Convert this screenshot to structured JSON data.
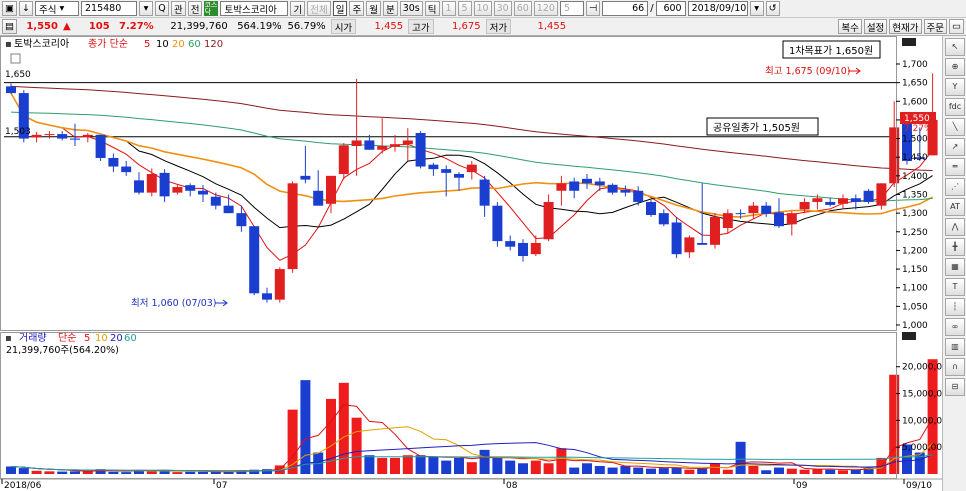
{
  "toolbar1": {
    "market": "주식",
    "code": "215480",
    "btn_rel": "관",
    "btn_all": "전",
    "badge": "코스닥",
    "stock_name": "토박스코리아",
    "btn_period": "기",
    "btn_all2": "전체",
    "periods": [
      "일",
      "주",
      "월",
      "분",
      "30s",
      "틱"
    ],
    "period_nums": [
      "1",
      "5",
      "10",
      "30",
      "60",
      "120"
    ],
    "spin_value": "5",
    "count": "66",
    "total": "600",
    "date": "2018/09/10"
  },
  "toolbar2": {
    "price": "1,550",
    "change_arrow": "▲",
    "change": "105",
    "change_pct": "7.27%",
    "volume": "21,399,760",
    "vol_pct": "564.19%",
    "rate": "56.79%",
    "open_label": "시가",
    "open": "1,455",
    "high_label": "고가",
    "high": "1,675",
    "low_label": "저가",
    "low": "1,455",
    "buttons": [
      "복수",
      "설정",
      "현재가",
      "주문"
    ]
  },
  "price_panel": {
    "name": "토박스코리아",
    "ma_label": "종가 단순",
    "ma_periods": [
      "5",
      "10",
      "20",
      "60",
      "120"
    ],
    "ma_colors": [
      "#e01010",
      "#000000",
      "#f09010",
      "#2e9e6a",
      "#8b1a1a"
    ],
    "hline_label": "1,650",
    "hline_left": "1,503",
    "target_box": "1차목표가 1,650원",
    "high_note": "최고 1,675 (09/10)",
    "offer_box": "공유일종가 1,505원",
    "low_note": "최저 1,060 (07/03)",
    "price_tag": "1,550",
    "pct_tag": "7.27%",
    "y_ticks": [
      "1,700",
      "1,650",
      "1,600",
      "1,550",
      "1,500",
      "1,450",
      "1,400",
      "1,350",
      "1,300",
      "1,250",
      "1,200",
      "1,150",
      "1,100",
      "1,050",
      "1,000"
    ]
  },
  "volume_panel": {
    "label": "거래량",
    "ma_label": "단순",
    "ma_periods": [
      "5",
      "10",
      "20",
      "60"
    ],
    "ma_colors": [
      "#e01010",
      "#e0a000",
      "#2020c0",
      "#20a0a0"
    ],
    "value": "21,399,760주(564.20%)",
    "y_ticks": [
      "20,000,00",
      "15,000,00",
      "10,000,00",
      "5,000,00"
    ]
  },
  "x_axis": [
    "2018/06",
    "07",
    "08",
    "09",
    "09/10"
  ],
  "colors": {
    "up": "#e02020",
    "down": "#1a3fd0",
    "hline": "#000000",
    "vol_up": "#ee1c1c",
    "vol_down": "#1a3fd0"
  },
  "right_tools": [
    "cursor-icon",
    "zoom-icon",
    "indicator-icon",
    "fdc-icon",
    "trend-line-icon",
    "arrow-line-icon",
    "parallel-icon",
    "fan-icon",
    "auto-icon",
    "wave-icon",
    "cross-icon",
    "grid-icon",
    "text-icon",
    "vertical-line-icon",
    "link-all-icon",
    "chart-icon",
    "magnet-icon",
    "lock-icon"
  ],
  "chart_data": {
    "type": "candlestick",
    "ylim": [
      1000,
      1700
    ],
    "candles": [
      {
        "o": 1640,
        "h": 1648,
        "l": 1620,
        "c": 1622
      },
      {
        "o": 1622,
        "h": 1630,
        "l": 1490,
        "c": 1500
      },
      {
        "o": 1503,
        "h": 1518,
        "l": 1490,
        "c": 1510
      },
      {
        "o": 1510,
        "h": 1520,
        "l": 1500,
        "c": 1512
      },
      {
        "o": 1512,
        "h": 1520,
        "l": 1495,
        "c": 1500
      },
      {
        "o": 1500,
        "h": 1540,
        "l": 1480,
        "c": 1497
      },
      {
        "o": 1506,
        "h": 1515,
        "l": 1490,
        "c": 1510
      },
      {
        "o": 1510,
        "h": 1510,
        "l": 1440,
        "c": 1448
      },
      {
        "o": 1448,
        "h": 1460,
        "l": 1410,
        "c": 1425
      },
      {
        "o": 1425,
        "h": 1440,
        "l": 1400,
        "c": 1410
      },
      {
        "o": 1388,
        "h": 1410,
        "l": 1350,
        "c": 1355
      },
      {
        "o": 1355,
        "h": 1420,
        "l": 1345,
        "c": 1405
      },
      {
        "o": 1408,
        "h": 1418,
        "l": 1330,
        "c": 1345
      },
      {
        "o": 1355,
        "h": 1375,
        "l": 1350,
        "c": 1370
      },
      {
        "o": 1375,
        "h": 1380,
        "l": 1345,
        "c": 1360
      },
      {
        "o": 1360,
        "h": 1375,
        "l": 1330,
        "c": 1350
      },
      {
        "o": 1344,
        "h": 1355,
        "l": 1310,
        "c": 1320
      },
      {
        "o": 1320,
        "h": 1350,
        "l": 1300,
        "c": 1300
      },
      {
        "o": 1300,
        "h": 1320,
        "l": 1250,
        "c": 1265
      },
      {
        "o": 1265,
        "h": 1265,
        "l": 1080,
        "c": 1085
      },
      {
        "o": 1085,
        "h": 1100,
        "l": 1060,
        "c": 1068
      },
      {
        "o": 1068,
        "h": 1155,
        "l": 1060,
        "c": 1150
      },
      {
        "o": 1150,
        "h": 1385,
        "l": 1140,
        "c": 1380
      },
      {
        "o": 1400,
        "h": 1480,
        "l": 1380,
        "c": 1390
      },
      {
        "o": 1360,
        "h": 1415,
        "l": 1330,
        "c": 1320
      },
      {
        "o": 1325,
        "h": 1400,
        "l": 1300,
        "c": 1400
      },
      {
        "o": 1405,
        "h": 1488,
        "l": 1390,
        "c": 1482
      },
      {
        "o": 1480,
        "h": 1660,
        "l": 1400,
        "c": 1495
      },
      {
        "o": 1495,
        "h": 1510,
        "l": 1470,
        "c": 1470
      },
      {
        "o": 1470,
        "h": 1555,
        "l": 1460,
        "c": 1480
      },
      {
        "o": 1478,
        "h": 1510,
        "l": 1465,
        "c": 1485
      },
      {
        "o": 1485,
        "h": 1528,
        "l": 1440,
        "c": 1495
      },
      {
        "o": 1515,
        "h": 1520,
        "l": 1420,
        "c": 1425
      },
      {
        "o": 1430,
        "h": 1435,
        "l": 1400,
        "c": 1418
      },
      {
        "o": 1418,
        "h": 1428,
        "l": 1345,
        "c": 1408
      },
      {
        "o": 1405,
        "h": 1410,
        "l": 1360,
        "c": 1395
      },
      {
        "o": 1410,
        "h": 1440,
        "l": 1390,
        "c": 1430
      },
      {
        "o": 1390,
        "h": 1400,
        "l": 1290,
        "c": 1320
      },
      {
        "o": 1320,
        "h": 1330,
        "l": 1210,
        "c": 1225
      },
      {
        "o": 1225,
        "h": 1240,
        "l": 1200,
        "c": 1210
      },
      {
        "o": 1220,
        "h": 1230,
        "l": 1170,
        "c": 1185
      },
      {
        "o": 1190,
        "h": 1240,
        "l": 1185,
        "c": 1220
      },
      {
        "o": 1230,
        "h": 1350,
        "l": 1225,
        "c": 1330
      },
      {
        "o": 1360,
        "h": 1400,
        "l": 1320,
        "c": 1380
      },
      {
        "o": 1385,
        "h": 1395,
        "l": 1340,
        "c": 1360
      },
      {
        "o": 1392,
        "h": 1405,
        "l": 1365,
        "c": 1380
      },
      {
        "o": 1385,
        "h": 1395,
        "l": 1360,
        "c": 1375
      },
      {
        "o": 1376,
        "h": 1380,
        "l": 1350,
        "c": 1355
      },
      {
        "o": 1362,
        "h": 1374,
        "l": 1345,
        "c": 1355
      },
      {
        "o": 1360,
        "h": 1372,
        "l": 1320,
        "c": 1330
      },
      {
        "o": 1330,
        "h": 1335,
        "l": 1290,
        "c": 1295
      },
      {
        "o": 1300,
        "h": 1310,
        "l": 1265,
        "c": 1270
      },
      {
        "o": 1275,
        "h": 1290,
        "l": 1180,
        "c": 1190
      },
      {
        "o": 1195,
        "h": 1240,
        "l": 1180,
        "c": 1235
      },
      {
        "o": 1220,
        "h": 1380,
        "l": 1220,
        "c": 1215
      },
      {
        "o": 1215,
        "h": 1300,
        "l": 1205,
        "c": 1290
      },
      {
        "o": 1260,
        "h": 1310,
        "l": 1245,
        "c": 1300
      },
      {
        "o": 1300,
        "h": 1310,
        "l": 1285,
        "c": 1298
      },
      {
        "o": 1300,
        "h": 1330,
        "l": 1285,
        "c": 1320
      },
      {
        "o": 1320,
        "h": 1330,
        "l": 1290,
        "c": 1298
      },
      {
        "o": 1302,
        "h": 1340,
        "l": 1260,
        "c": 1265
      },
      {
        "o": 1270,
        "h": 1305,
        "l": 1240,
        "c": 1300
      },
      {
        "o": 1310,
        "h": 1340,
        "l": 1300,
        "c": 1330
      },
      {
        "o": 1330,
        "h": 1350,
        "l": 1310,
        "c": 1340
      },
      {
        "o": 1330,
        "h": 1342,
        "l": 1318,
        "c": 1322
      },
      {
        "o": 1325,
        "h": 1350,
        "l": 1310,
        "c": 1340
      },
      {
        "o": 1340,
        "h": 1350,
        "l": 1310,
        "c": 1330
      },
      {
        "o": 1360,
        "h": 1365,
        "l": 1325,
        "c": 1330
      },
      {
        "o": 1320,
        "h": 1380,
        "l": 1310,
        "c": 1380
      },
      {
        "o": 1380,
        "h": 1600,
        "l": 1370,
        "c": 1530
      },
      {
        "o": 1540,
        "h": 1560,
        "l": 1430,
        "c": 1440
      },
      {
        "o": 1450,
        "h": 1530,
        "l": 1440,
        "c": 1445
      },
      {
        "o": 1455,
        "h": 1675,
        "l": 1455,
        "c": 1550
      }
    ],
    "volumes": [
      1400000,
      1100000,
      600000,
      500000,
      450000,
      500000,
      600000,
      900000,
      400000,
      350000,
      700000,
      650000,
      700000,
      350000,
      400000,
      400000,
      400000,
      400000,
      700000,
      800000,
      900000,
      1600000,
      12000000,
      17500000,
      4000000,
      14000000,
      17000000,
      10500000,
      3500000,
      3000000,
      3000000,
      3500000,
      3500000,
      3200000,
      2500000,
      3000000,
      2200000,
      4500000,
      3000000,
      2500000,
      2000000,
      2500000,
      2000000,
      4800000,
      1200000,
      2000000,
      1500000,
      1200000,
      1500000,
      1200000,
      1000000,
      1100000,
      1200000,
      800000,
      1000000,
      2000000,
      800000,
      6000000,
      1500000,
      700000,
      1200000,
      1000000,
      800000,
      900000,
      800000,
      700000,
      800000,
      1200000,
      3000000,
      18500000,
      5500000,
      4000000,
      21400000
    ]
  }
}
